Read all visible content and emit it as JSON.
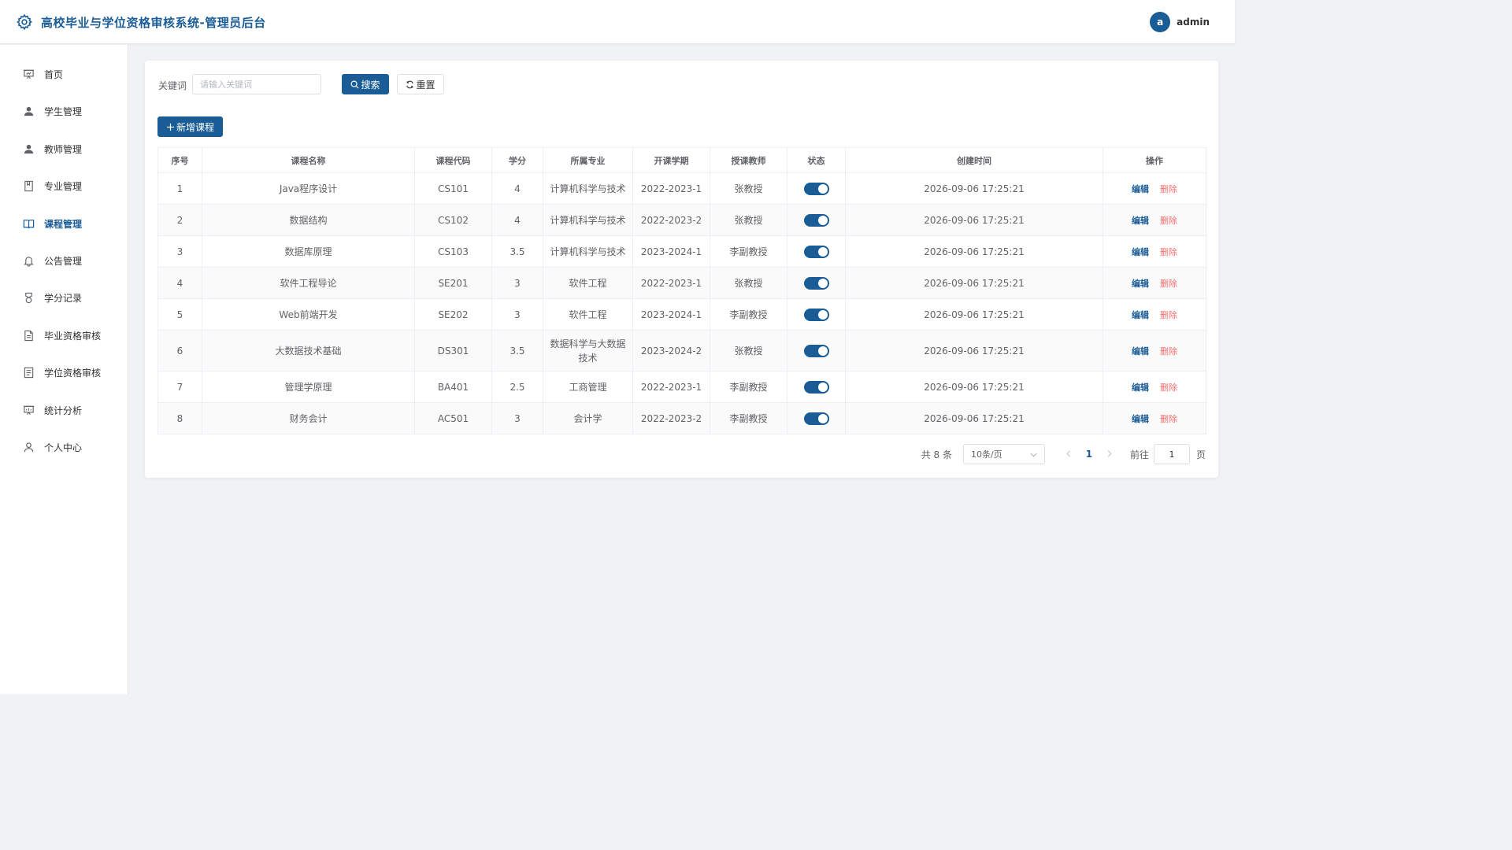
{
  "header": {
    "title": "高校毕业与学位资格审核系统-管理员后台",
    "avatar_letter": "a",
    "username": "admin",
    "logo_icon": "gear-icon"
  },
  "sidebar": {
    "items": [
      {
        "label": "首页",
        "icon": "presentation-icon",
        "active": false
      },
      {
        "label": "学生管理",
        "icon": "user-filled-icon",
        "active": false
      },
      {
        "label": "教师管理",
        "icon": "user-filled-icon",
        "active": false
      },
      {
        "label": "专业管理",
        "icon": "notebook-icon",
        "active": false
      },
      {
        "label": "课程管理",
        "icon": "open-book-icon",
        "active": true
      },
      {
        "label": "公告管理",
        "icon": "bell-icon",
        "active": false
      },
      {
        "label": "学分记录",
        "icon": "medal-icon",
        "active": false
      },
      {
        "label": "毕业资格审核",
        "icon": "document-icon",
        "active": false
      },
      {
        "label": "学位资格审核",
        "icon": "tickets-icon",
        "active": false
      },
      {
        "label": "统计分析",
        "icon": "data-board-icon",
        "active": false
      },
      {
        "label": "个人中心",
        "icon": "user-outline-icon",
        "active": false
      }
    ]
  },
  "search": {
    "label": "关键词",
    "placeholder": "请输入关键词",
    "value": "",
    "search_label": "搜索",
    "reset_label": "重置"
  },
  "toolbar": {
    "add_label": "新增课程"
  },
  "table": {
    "columns": [
      "序号",
      "课程名称",
      "课程代码",
      "学分",
      "所属专业",
      "开课学期",
      "授课教师",
      "状态",
      "创建时间",
      "操作"
    ],
    "edit_label": "编辑",
    "delete_label": "删除",
    "rows": [
      {
        "index": "1",
        "name": "Java程序设计",
        "code": "CS101",
        "credit": "4",
        "major": "计算机科学与技术",
        "term": "2022-2023-1",
        "teacher": "张教授",
        "status": true,
        "created": "2026-09-06 17:25:21"
      },
      {
        "index": "2",
        "name": "数据结构",
        "code": "CS102",
        "credit": "4",
        "major": "计算机科学与技术",
        "term": "2022-2023-2",
        "teacher": "张教授",
        "status": true,
        "created": "2026-09-06 17:25:21"
      },
      {
        "index": "3",
        "name": "数据库原理",
        "code": "CS103",
        "credit": "3.5",
        "major": "计算机科学与技术",
        "term": "2023-2024-1",
        "teacher": "李副教授",
        "status": true,
        "created": "2026-09-06 17:25:21"
      },
      {
        "index": "4",
        "name": "软件工程导论",
        "code": "SE201",
        "credit": "3",
        "major": "软件工程",
        "term": "2022-2023-1",
        "teacher": "张教授",
        "status": true,
        "created": "2026-09-06 17:25:21"
      },
      {
        "index": "5",
        "name": "Web前端开发",
        "code": "SE202",
        "credit": "3",
        "major": "软件工程",
        "term": "2023-2024-1",
        "teacher": "李副教授",
        "status": true,
        "created": "2026-09-06 17:25:21"
      },
      {
        "index": "6",
        "name": "大数据技术基础",
        "code": "DS301",
        "credit": "3.5",
        "major": "数据科学与大数据技术",
        "term": "2023-2024-2",
        "teacher": "张教授",
        "status": true,
        "created": "2026-09-06 17:25:21"
      },
      {
        "index": "7",
        "name": "管理学原理",
        "code": "BA401",
        "credit": "2.5",
        "major": "工商管理",
        "term": "2022-2023-1",
        "teacher": "李副教授",
        "status": true,
        "created": "2026-09-06 17:25:21"
      },
      {
        "index": "8",
        "name": "财务会计",
        "code": "AC501",
        "credit": "3",
        "major": "会计学",
        "term": "2022-2023-2",
        "teacher": "李副教授",
        "status": true,
        "created": "2026-09-06 17:25:21"
      }
    ]
  },
  "pagination": {
    "total_label": "共 8 条",
    "page_size": "10条/页",
    "current_page": "1",
    "goto_label": "前往",
    "goto_value": "1",
    "page_suffix": "页"
  },
  "colors": {
    "primary": "#1a5c96",
    "danger": "#f56c6c",
    "background": "#f0f2f5"
  }
}
